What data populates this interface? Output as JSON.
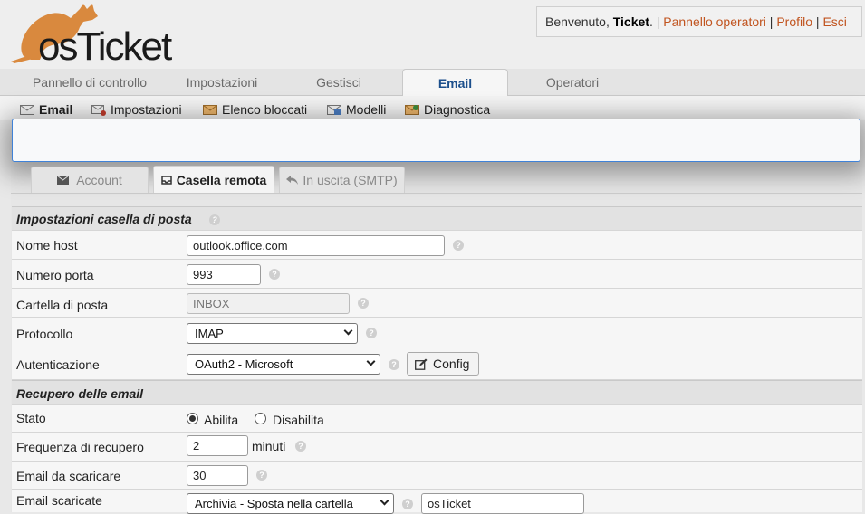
{
  "header": {
    "logo_text": "osTicket",
    "welcome_prefix": "Benvenuto, ",
    "username": "Ticket",
    "links": [
      "Pannello operatori",
      "Profilo",
      "Esci"
    ]
  },
  "nav": {
    "tabs": [
      {
        "label": "Pannello di controllo"
      },
      {
        "label": "Impostazioni"
      },
      {
        "label": "Gestisci"
      },
      {
        "label": "Email"
      },
      {
        "label": "Operatori"
      }
    ]
  },
  "subnav": {
    "items": [
      {
        "label": "Email",
        "icon": "envelope-icon"
      },
      {
        "label": "Impostazioni",
        "icon": "mail-settings-icon"
      },
      {
        "label": "Elenco bloccati",
        "icon": "mail-blocked-icon"
      },
      {
        "label": "Modelli",
        "icon": "mail-templates-icon"
      },
      {
        "label": "Diagnostica",
        "icon": "mail-diagnostic-icon"
      }
    ]
  },
  "tabs": {
    "account": "Account",
    "remote": "Casella remota",
    "outgoing": "In uscita (SMTP)"
  },
  "mailbox": {
    "section_title": "Impostazioni casella di posta",
    "hostname_label": "Nome host",
    "hostname_value": "outlook.office.com",
    "port_label": "Numero porta",
    "port_value": "993",
    "folder_label": "Cartella di posta",
    "folder_placeholder": "INBOX",
    "protocol_label": "Protocollo",
    "protocol_value": "IMAP",
    "auth_label": "Autenticazione",
    "auth_value": "OAuth2 - Microsoft",
    "config_button": "Config"
  },
  "fetch": {
    "section_title": "Recupero delle email",
    "status_label": "Stato",
    "enable_label": "Abilita",
    "disable_label": "Disabilita",
    "frequency_label": "Frequenza di recupero",
    "frequency_value": "2",
    "frequency_unit": "minuti",
    "count_label": "Email da scaricare",
    "count_value": "30",
    "fetched_label": "Email scaricate",
    "fetched_action": "Archivia - Sposta nella cartella",
    "archive_folder": "osTicket"
  }
}
